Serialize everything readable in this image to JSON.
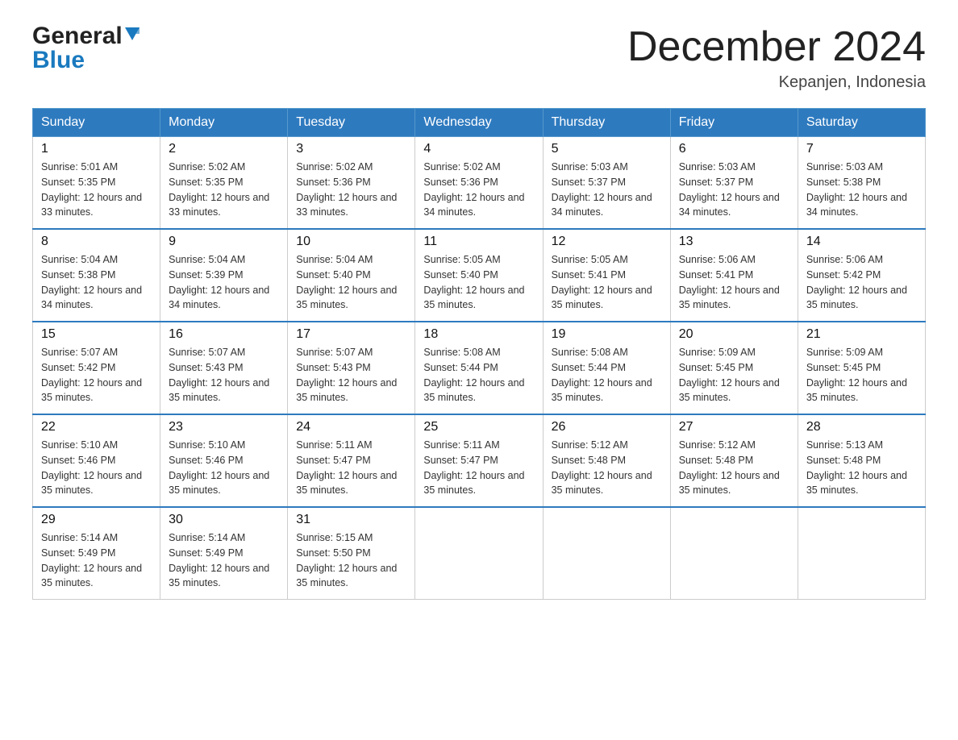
{
  "header": {
    "logo_general": "General",
    "logo_blue": "Blue",
    "month_title": "December 2024",
    "location": "Kepanjen, Indonesia"
  },
  "weekdays": [
    "Sunday",
    "Monday",
    "Tuesday",
    "Wednesday",
    "Thursday",
    "Friday",
    "Saturday"
  ],
  "weeks": [
    [
      {
        "day": "1",
        "sunrise": "5:01 AM",
        "sunset": "5:35 PM",
        "daylight": "12 hours and 33 minutes."
      },
      {
        "day": "2",
        "sunrise": "5:02 AM",
        "sunset": "5:35 PM",
        "daylight": "12 hours and 33 minutes."
      },
      {
        "day": "3",
        "sunrise": "5:02 AM",
        "sunset": "5:36 PM",
        "daylight": "12 hours and 33 minutes."
      },
      {
        "day": "4",
        "sunrise": "5:02 AM",
        "sunset": "5:36 PM",
        "daylight": "12 hours and 34 minutes."
      },
      {
        "day": "5",
        "sunrise": "5:03 AM",
        "sunset": "5:37 PM",
        "daylight": "12 hours and 34 minutes."
      },
      {
        "day": "6",
        "sunrise": "5:03 AM",
        "sunset": "5:37 PM",
        "daylight": "12 hours and 34 minutes."
      },
      {
        "day": "7",
        "sunrise": "5:03 AM",
        "sunset": "5:38 PM",
        "daylight": "12 hours and 34 minutes."
      }
    ],
    [
      {
        "day": "8",
        "sunrise": "5:04 AM",
        "sunset": "5:38 PM",
        "daylight": "12 hours and 34 minutes."
      },
      {
        "day": "9",
        "sunrise": "5:04 AM",
        "sunset": "5:39 PM",
        "daylight": "12 hours and 34 minutes."
      },
      {
        "day": "10",
        "sunrise": "5:04 AM",
        "sunset": "5:40 PM",
        "daylight": "12 hours and 35 minutes."
      },
      {
        "day": "11",
        "sunrise": "5:05 AM",
        "sunset": "5:40 PM",
        "daylight": "12 hours and 35 minutes."
      },
      {
        "day": "12",
        "sunrise": "5:05 AM",
        "sunset": "5:41 PM",
        "daylight": "12 hours and 35 minutes."
      },
      {
        "day": "13",
        "sunrise": "5:06 AM",
        "sunset": "5:41 PM",
        "daylight": "12 hours and 35 minutes."
      },
      {
        "day": "14",
        "sunrise": "5:06 AM",
        "sunset": "5:42 PM",
        "daylight": "12 hours and 35 minutes."
      }
    ],
    [
      {
        "day": "15",
        "sunrise": "5:07 AM",
        "sunset": "5:42 PM",
        "daylight": "12 hours and 35 minutes."
      },
      {
        "day": "16",
        "sunrise": "5:07 AM",
        "sunset": "5:43 PM",
        "daylight": "12 hours and 35 minutes."
      },
      {
        "day": "17",
        "sunrise": "5:07 AM",
        "sunset": "5:43 PM",
        "daylight": "12 hours and 35 minutes."
      },
      {
        "day": "18",
        "sunrise": "5:08 AM",
        "sunset": "5:44 PM",
        "daylight": "12 hours and 35 minutes."
      },
      {
        "day": "19",
        "sunrise": "5:08 AM",
        "sunset": "5:44 PM",
        "daylight": "12 hours and 35 minutes."
      },
      {
        "day": "20",
        "sunrise": "5:09 AM",
        "sunset": "5:45 PM",
        "daylight": "12 hours and 35 minutes."
      },
      {
        "day": "21",
        "sunrise": "5:09 AM",
        "sunset": "5:45 PM",
        "daylight": "12 hours and 35 minutes."
      }
    ],
    [
      {
        "day": "22",
        "sunrise": "5:10 AM",
        "sunset": "5:46 PM",
        "daylight": "12 hours and 35 minutes."
      },
      {
        "day": "23",
        "sunrise": "5:10 AM",
        "sunset": "5:46 PM",
        "daylight": "12 hours and 35 minutes."
      },
      {
        "day": "24",
        "sunrise": "5:11 AM",
        "sunset": "5:47 PM",
        "daylight": "12 hours and 35 minutes."
      },
      {
        "day": "25",
        "sunrise": "5:11 AM",
        "sunset": "5:47 PM",
        "daylight": "12 hours and 35 minutes."
      },
      {
        "day": "26",
        "sunrise": "5:12 AM",
        "sunset": "5:48 PM",
        "daylight": "12 hours and 35 minutes."
      },
      {
        "day": "27",
        "sunrise": "5:12 AM",
        "sunset": "5:48 PM",
        "daylight": "12 hours and 35 minutes."
      },
      {
        "day": "28",
        "sunrise": "5:13 AM",
        "sunset": "5:48 PM",
        "daylight": "12 hours and 35 minutes."
      }
    ],
    [
      {
        "day": "29",
        "sunrise": "5:14 AM",
        "sunset": "5:49 PM",
        "daylight": "12 hours and 35 minutes."
      },
      {
        "day": "30",
        "sunrise": "5:14 AM",
        "sunset": "5:49 PM",
        "daylight": "12 hours and 35 minutes."
      },
      {
        "day": "31",
        "sunrise": "5:15 AM",
        "sunset": "5:50 PM",
        "daylight": "12 hours and 35 minutes."
      },
      null,
      null,
      null,
      null
    ]
  ]
}
